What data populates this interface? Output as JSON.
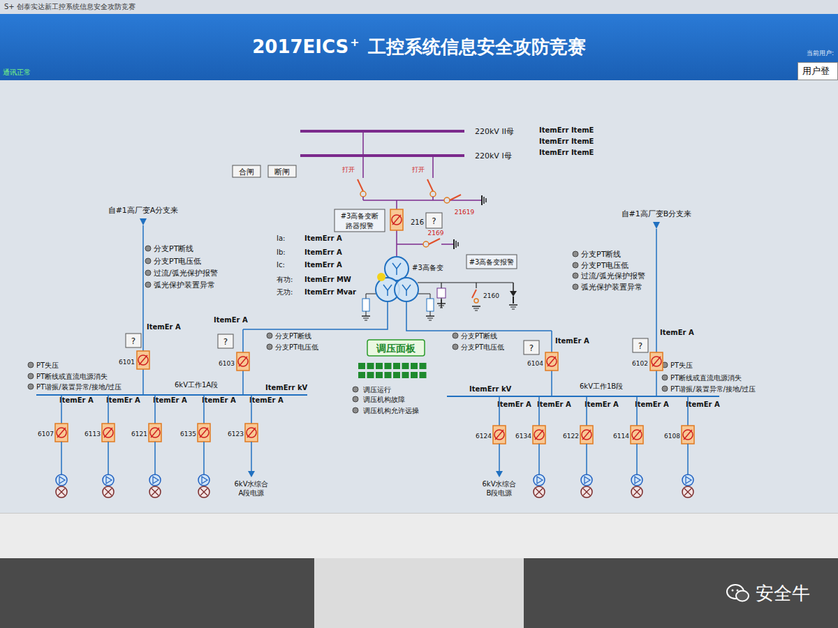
{
  "window": {
    "title": "S+ 创泰实达新工控系统信息安全攻防竞赛"
  },
  "header": {
    "title": "2017EICS",
    "title_mark": "+",
    "subtitle": "工控系统信息安全攻防竞赛",
    "status": "通讯正常",
    "user_label": "当前用户:",
    "login_button": "用户登"
  },
  "hv": {
    "buses": [
      "220kV II母",
      "220kV I母"
    ],
    "bus_readings": [
      "ItemErr ItemE",
      "ItemErr ItemE",
      "ItemErr ItemE"
    ],
    "buttons": [
      "合闸",
      "断闸"
    ],
    "disconnector_labels": [
      "打开",
      "打开"
    ],
    "ground_switches": [
      "21619",
      "2169",
      "2160"
    ],
    "breaker": {
      "number": "216",
      "help": "?",
      "alarm_lines": [
        "#3高备变断",
        "路器报警"
      ]
    },
    "transformer": {
      "name": "#3高备变",
      "alarm": "#3高备变报警"
    },
    "measurements": [
      {
        "label": "Ia:",
        "value": "ItemErr A"
      },
      {
        "label": "Ib:",
        "value": "ItemErr A"
      },
      {
        "label": "Ic:",
        "value": "ItemErr A"
      },
      {
        "label": "有功:",
        "value": "ItemErr MW"
      },
      {
        "label": "无功:",
        "value": "ItemErr Mvar"
      }
    ]
  },
  "sections": [
    {
      "name": "6kV工作1A段",
      "voltage": "ItemErr kV",
      "feed": {
        "label": "自#1高厂变A分支来",
        "alarms": [
          {
            "label": "分支PT断线",
            "active": false
          },
          {
            "label": "分支PT电压低",
            "active": false
          },
          {
            "label": "过流/弧光保护报警",
            "active": false
          },
          {
            "label": "弧光保护装置异常",
            "active": false
          }
        ]
      },
      "alarms": [
        {
          "label": "PT失压",
          "active": false
        },
        {
          "label": "PT断线或直流电源消失",
          "active": false
        },
        {
          "label": "PT谐振/装置异常/接地/过压",
          "active": false
        }
      ],
      "incomers": [
        {
          "number": "6101",
          "current": "ItemEr A",
          "help": "?",
          "alarms": []
        },
        {
          "number": "6103",
          "current": "ItemEr A",
          "help": "?",
          "alarms": [
            {
              "label": "分支PT断线",
              "active": false
            },
            {
              "label": "分支PT电压低",
              "active": false
            }
          ]
        }
      ],
      "feeders": [
        {
          "number": "6107",
          "current": "ItemEr A",
          "kind": "motor",
          "target": []
        },
        {
          "number": "6113",
          "current": "ItemEr A",
          "kind": "motor",
          "target": []
        },
        {
          "number": "6121",
          "current": "ItemEr A",
          "kind": "motor",
          "target": []
        },
        {
          "number": "6135",
          "current": "ItemEr A",
          "kind": "motor",
          "target": []
        },
        {
          "number": "6123",
          "current": "ItemEr A",
          "kind": "supply",
          "target": [
            "6kV水综合",
            "A段电源"
          ]
        }
      ]
    },
    {
      "name": "6kV工作1B段",
      "voltage": "ItemErr kV",
      "feed": {
        "label": "自#1高厂变B分支来",
        "alarms": [
          {
            "label": "分支PT断线",
            "active": false
          },
          {
            "label": "分支PT电压低",
            "active": false
          },
          {
            "label": "过流/弧光保护报警",
            "active": false
          },
          {
            "label": "弧光保护装置异常",
            "active": false
          }
        ]
      },
      "alarms": [
        {
          "label": "PT失压",
          "active": false
        },
        {
          "label": "PT断线或直流电源消失",
          "active": false
        },
        {
          "label": "PT谐振/装置异常/接地/过压",
          "active": false
        }
      ],
      "incomers": [
        {
          "number": "6104",
          "current": "ItemEr A",
          "help": "?",
          "alarms": [
            {
              "label": "分支PT断线",
              "active": false
            },
            {
              "label": "分支PT电压低",
              "active": false
            }
          ]
        },
        {
          "number": "6102",
          "current": "ItemEr A",
          "help": "?",
          "alarms": []
        }
      ],
      "feeders": [
        {
          "number": "6124",
          "current": "ItemEr A",
          "kind": "supply",
          "target": [
            "6kV水综合",
            "B段电源"
          ]
        },
        {
          "number": "6134",
          "current": "ItemEr A",
          "kind": "motor",
          "target": []
        },
        {
          "number": "6122",
          "current": "ItemEr A",
          "kind": "motor",
          "target": []
        },
        {
          "number": "6114",
          "current": "ItemEr A",
          "kind": "motor",
          "target": []
        },
        {
          "number": "6108",
          "current": "ItemEr A",
          "kind": "motor",
          "target": []
        }
      ]
    }
  ],
  "tap_panel": {
    "button": "调压面板",
    "indicators": [
      {
        "on": true
      },
      {
        "on": true
      },
      {
        "on": true
      },
      {
        "on": true
      },
      {
        "on": true
      },
      {
        "on": true
      },
      {
        "on": true
      },
      {
        "on": true
      },
      {
        "on": true
      },
      {
        "on": true
      },
      {
        "on": true
      },
      {
        "on": true
      },
      {
        "on": true
      },
      {
        "on": true
      },
      {
        "on": true
      },
      {
        "on": true
      }
    ],
    "status": [
      {
        "label": "调压运行",
        "active": false
      },
      {
        "label": "调压机构故障",
        "active": false
      },
      {
        "label": "调压机构允许远操",
        "active": false
      }
    ]
  },
  "watermark": "安全牛"
}
